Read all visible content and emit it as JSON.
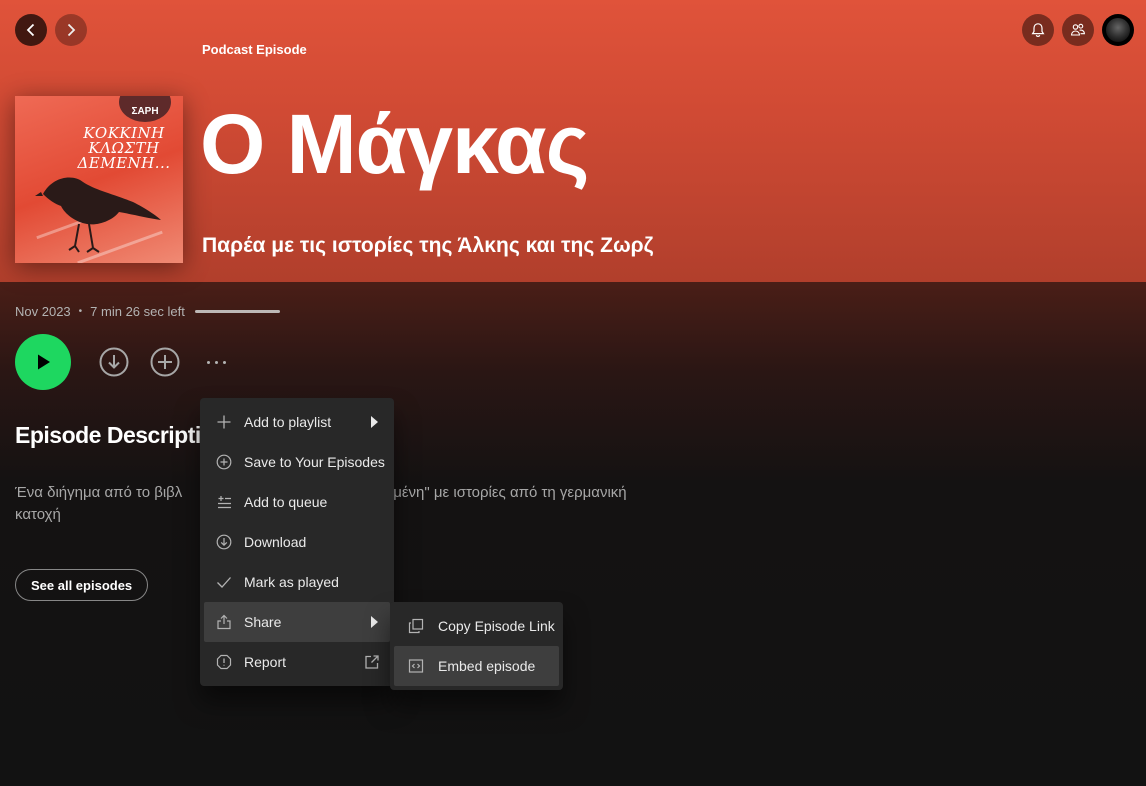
{
  "nav": {
    "back_icon": "chevron-left-icon",
    "forward_icon": "chevron-right-icon"
  },
  "topbar": {
    "icons": [
      "bell-icon",
      "friends-icon",
      "avatar"
    ]
  },
  "episode": {
    "type_label": "Podcast Episode",
    "title": "Ο Μάγκας",
    "show_name": "Παρέα με τις ιστορίες της Άλκης και της Ζωρζ",
    "date": "Nov 2023",
    "time_left": "7 min 26 sec left",
    "progress_fraction": 1.0,
    "cover": {
      "badge_text": "ΣΑΡΗ",
      "title_text": "ΚΟΚΚΙΝΗ ΚΛΩΣΤΗ ΔΕΜΕΝΗ..."
    }
  },
  "actions": {
    "play_icon": "play-icon",
    "download_icon": "download-icon",
    "add_icon": "plus-circle-icon",
    "more_icon": "more-icon"
  },
  "description": {
    "heading": "Episode Description",
    "text": "Ένα διήγημα από το βιβλ                                  κλωστή δεμένη\" με ιστορίες από τη γερμανική κατοχή"
  },
  "see_all_label": "See all episodes",
  "context_menu": {
    "items": [
      {
        "label": "Add to playlist",
        "icon": "plus-icon",
        "has_submenu": true
      },
      {
        "label": "Save to Your Episodes",
        "icon": "plus-circle-icon"
      },
      {
        "label": "Add to queue",
        "icon": "queue-icon"
      },
      {
        "label": "Download",
        "icon": "download-icon"
      },
      {
        "label": "Mark as played",
        "icon": "check-icon"
      },
      {
        "label": "Share",
        "icon": "share-icon",
        "has_submenu": true,
        "highlighted": true
      },
      {
        "label": "Report",
        "icon": "report-icon",
        "external": true
      }
    ]
  },
  "share_submenu": {
    "items": [
      {
        "label": "Copy Episode Link",
        "icon": "copy-icon"
      },
      {
        "label": "Embed episode",
        "icon": "embed-icon",
        "highlighted": true
      }
    ]
  },
  "colors": {
    "header": "#d04a34",
    "play_button": "#1ed760",
    "menu_bg": "#282828",
    "menu_hover": "#3e3e3e"
  }
}
